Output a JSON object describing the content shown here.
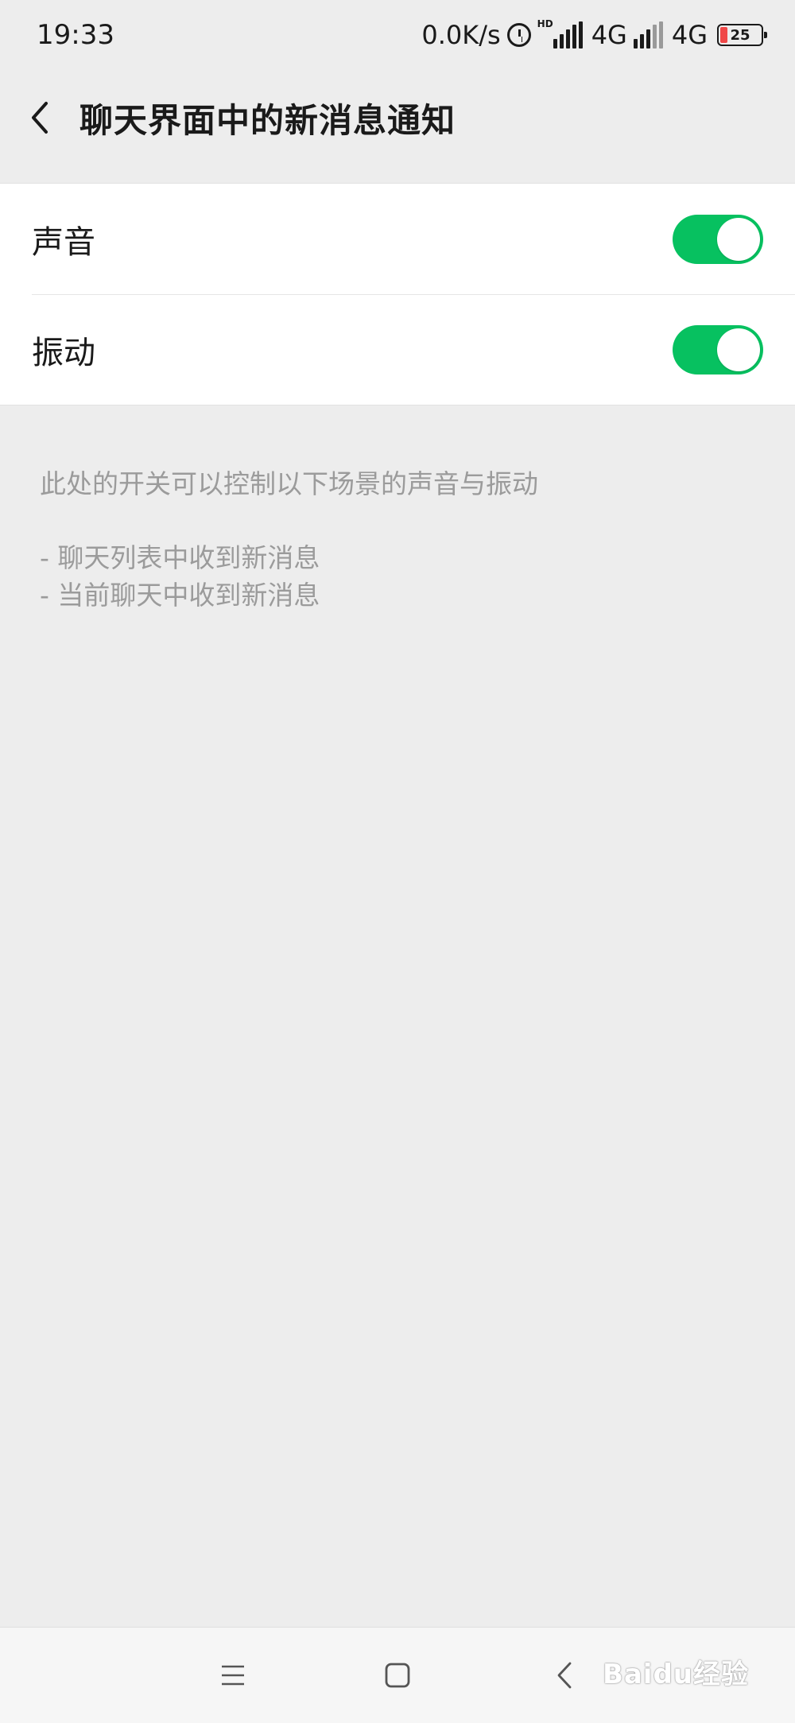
{
  "status_bar": {
    "time": "19:33",
    "net_speed": "0.0K/s",
    "hd_label": "HD",
    "network1": "4G",
    "network2": "4G",
    "battery_level": "25",
    "battery_color": "#f04848"
  },
  "header": {
    "back_icon": "chevron-left-icon",
    "title": "聊天界面中的新消息通知"
  },
  "settings": {
    "items": [
      {
        "label": "声音",
        "enabled": true
      },
      {
        "label": "振动",
        "enabled": true
      }
    ],
    "toggle_on_color": "#07c160"
  },
  "description": {
    "intro": "此处的开关可以控制以下场景的声音与振动",
    "cases": [
      "- 聊天列表中收到新消息",
      "- 当前聊天中收到新消息"
    ]
  },
  "nav_bar": {
    "icons": [
      "menu-icon",
      "home-square-icon",
      "back-triangle-icon"
    ]
  },
  "watermark": "Baidu经验"
}
